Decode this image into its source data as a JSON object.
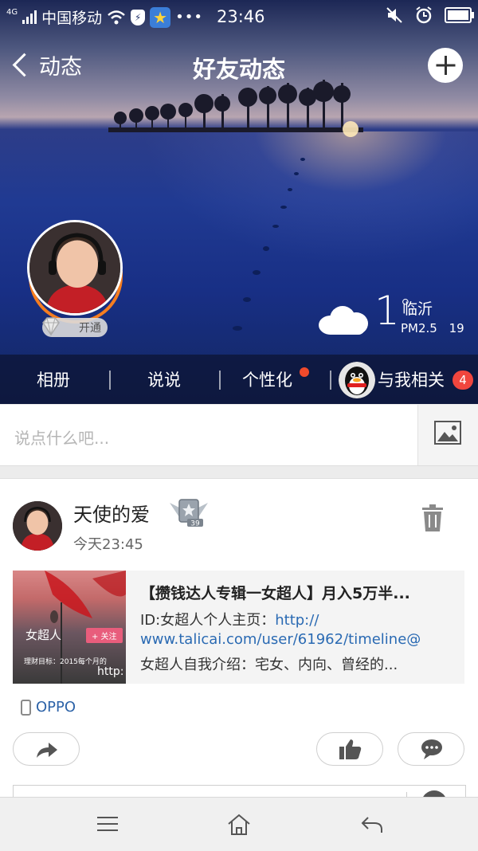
{
  "status_bar": {
    "network": "4G",
    "carrier": "中国移动",
    "time": "23:46"
  },
  "header": {
    "back_label": "动态",
    "title": "好友动态"
  },
  "profile": {
    "vip_button": "开通"
  },
  "weather": {
    "temperature": "1",
    "degree": "°",
    "city": "临沂",
    "pm_label": "PM2.5",
    "pm_value": "19"
  },
  "tabs": {
    "album": "相册",
    "shuoshuo": "说说",
    "personalize": "个性化",
    "related": "与我相关",
    "related_badge": "4"
  },
  "compose": {
    "placeholder": "说点什么吧..."
  },
  "post": {
    "username": "天使的爱",
    "level": "39",
    "time": "今天23:45",
    "share": {
      "title": "【攒钱达人专辑一女超人】月入5万半...",
      "line1_prefix": "ID:女超人个人主页：",
      "line1_link": "http://",
      "line2_link": "www.talicai.com/user/61962/timeline@",
      "line3": "女超人自我介绍：宅女、内向、曾经的...",
      "thumb_text": "女超人",
      "thumb_tag": "+ 关注",
      "thumb_small": "理财目标：2015每个月的",
      "thumb_link": "http:"
    },
    "device": "OPPO"
  },
  "colors": {
    "accent_link": "#2a6ab3",
    "badge_red": "#f0463e",
    "vip_ring": "#f57d20"
  }
}
